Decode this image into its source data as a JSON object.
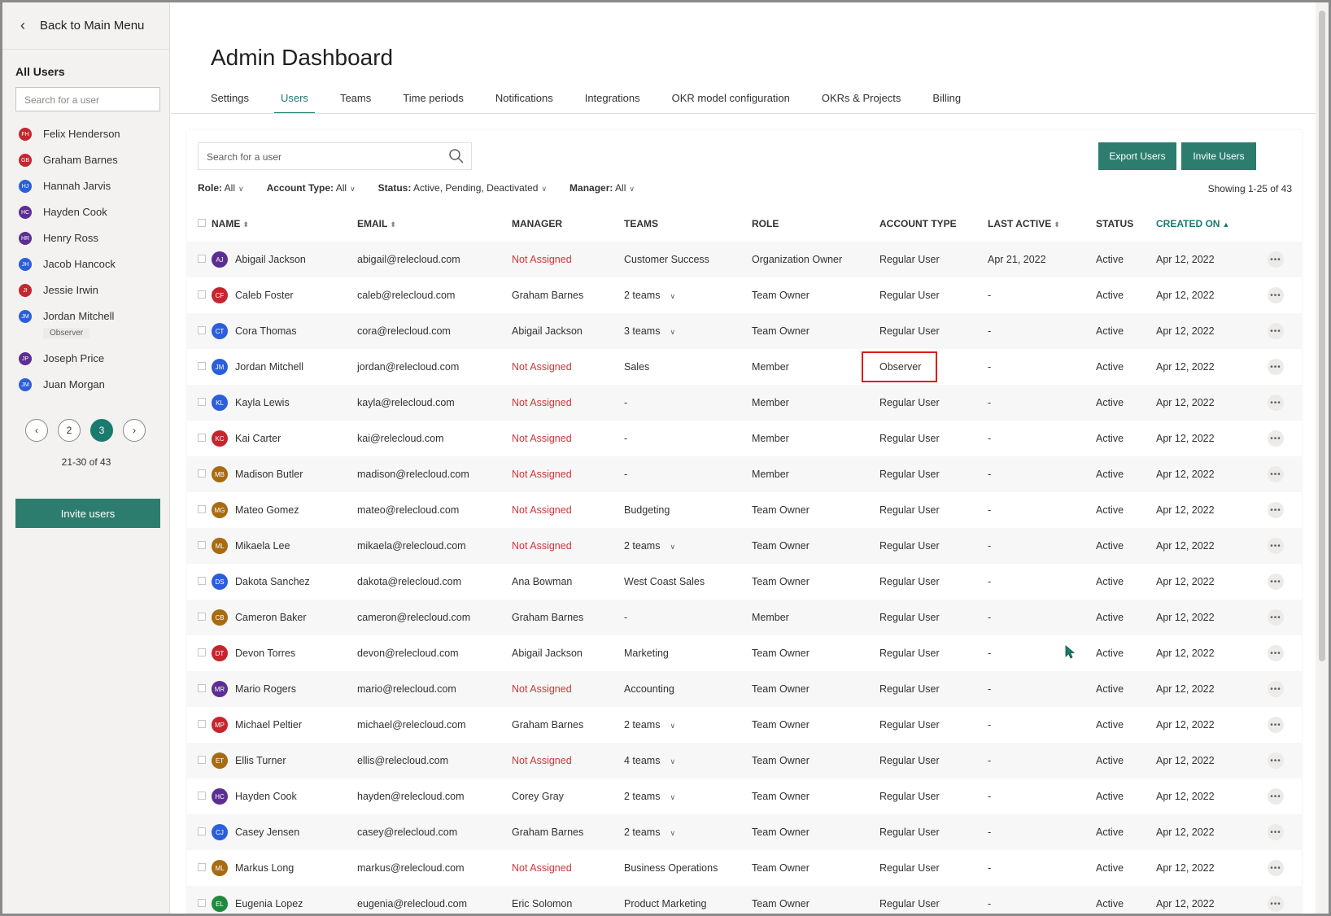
{
  "sidebar": {
    "back_label": "Back to Main Menu",
    "title": "All Users",
    "search_placeholder": "Search for a user",
    "users": [
      {
        "initials": "FH",
        "name": "Felix Henderson",
        "color": "#c4262e"
      },
      {
        "initials": "GB",
        "name": "Graham Barnes",
        "color": "#c4262e"
      },
      {
        "initials": "HJ",
        "name": "Hannah Jarvis",
        "color": "#2b5fd9"
      },
      {
        "initials": "HC",
        "name": "Hayden Cook",
        "color": "#5c2e91"
      },
      {
        "initials": "HR",
        "name": "Henry Ross",
        "color": "#5c2e91"
      },
      {
        "initials": "JH",
        "name": "Jacob Hancock",
        "color": "#2b5fd9"
      },
      {
        "initials": "JI",
        "name": "Jessie Irwin",
        "color": "#c4262e"
      },
      {
        "initials": "JM",
        "name": "Jordan Mitchell",
        "color": "#2b5fd9",
        "badge": "Observer"
      },
      {
        "initials": "JP",
        "name": "Joseph Price",
        "color": "#5c2e91"
      },
      {
        "initials": "JM",
        "name": "Juan Morgan",
        "color": "#2b5fd9"
      }
    ],
    "pager": {
      "prev": "‹",
      "pages": [
        "2",
        "3"
      ],
      "active": "3",
      "next": "›",
      "info": "21-30  of  43"
    },
    "invite_label": "Invite users"
  },
  "header": {
    "title": "Admin Dashboard",
    "tabs": [
      "Settings",
      "Users",
      "Teams",
      "Time periods",
      "Notifications",
      "Integrations",
      "OKR model configuration",
      "OKRs & Projects",
      "Billing"
    ],
    "active_tab": "Users"
  },
  "toolbar": {
    "search_placeholder": "Search for a user",
    "export_label": "Export Users",
    "invite_label": "Invite Users"
  },
  "filters": [
    {
      "label": "Role:",
      "value": "All"
    },
    {
      "label": "Account Type:",
      "value": "All"
    },
    {
      "label": "Status:",
      "value": "Active, Pending, Deactivated"
    },
    {
      "label": "Manager:",
      "value": "All"
    }
  ],
  "showing": "Showing 1-25 of 43",
  "table": {
    "columns": [
      "NAME",
      "EMAIL",
      "MANAGER",
      "TEAMS",
      "ROLE",
      "ACCOUNT TYPE",
      "LAST ACTIVE",
      "STATUS",
      "CREATED ON"
    ],
    "rows": [
      {
        "initials": "AJ",
        "color": "#5c2e91",
        "name": "Abigail Jackson",
        "email": "abigail@relecloud.com",
        "manager": "Not Assigned",
        "teams": "Customer Success",
        "teams_dd": false,
        "role": "Organization Owner",
        "account": "Regular User",
        "last": "Apr 21, 2022",
        "status": "Active",
        "created": "Apr 12, 2022"
      },
      {
        "initials": "CF",
        "color": "#c4262e",
        "name": "Caleb Foster",
        "email": "caleb@relecloud.com",
        "manager": "Graham Barnes",
        "teams": "2 teams",
        "teams_dd": true,
        "role": "Team Owner",
        "account": "Regular User",
        "last": "-",
        "status": "Active",
        "created": "Apr 12, 2022"
      },
      {
        "initials": "CT",
        "color": "#2b5fd9",
        "name": "Cora Thomas",
        "email": "cora@relecloud.com",
        "manager": "Abigail Jackson",
        "teams": "3 teams",
        "teams_dd": true,
        "role": "Team Owner",
        "account": "Regular User",
        "last": "-",
        "status": "Active",
        "created": "Apr 12, 2022"
      },
      {
        "initials": "JM",
        "color": "#2b5fd9",
        "name": "Jordan Mitchell",
        "email": "jordan@relecloud.com",
        "manager": "Not Assigned",
        "teams": "Sales",
        "teams_dd": false,
        "role": "Member",
        "account": "Observer",
        "highlight": true,
        "last": "-",
        "status": "Active",
        "created": "Apr 12, 2022"
      },
      {
        "initials": "KL",
        "color": "#2b5fd9",
        "name": "Kayla Lewis",
        "email": "kayla@relecloud.com",
        "manager": "Not Assigned",
        "teams": "-",
        "teams_dd": false,
        "role": "Member",
        "account": "Regular User",
        "last": "-",
        "status": "Active",
        "created": "Apr 12, 2022"
      },
      {
        "initials": "KC",
        "color": "#c4262e",
        "name": "Kai Carter",
        "email": "kai@relecloud.com",
        "manager": "Not Assigned",
        "teams": "-",
        "teams_dd": false,
        "role": "Member",
        "account": "Regular User",
        "last": "-",
        "status": "Active",
        "created": "Apr 12, 2022"
      },
      {
        "initials": "MB",
        "color": "#a86b12",
        "name": "Madison Butler",
        "email": "madison@relecloud.com",
        "manager": "Not Assigned",
        "teams": "-",
        "teams_dd": false,
        "role": "Member",
        "account": "Regular User",
        "last": "-",
        "status": "Active",
        "created": "Apr 12, 2022"
      },
      {
        "initials": "MG",
        "color": "#a86b12",
        "name": "Mateo Gomez",
        "email": "mateo@relecloud.com",
        "manager": "Not Assigned",
        "teams": "Budgeting",
        "teams_dd": false,
        "role": "Team Owner",
        "account": "Regular User",
        "last": "-",
        "status": "Active",
        "created": "Apr 12, 2022"
      },
      {
        "initials": "ML",
        "color": "#a86b12",
        "name": "Mikaela Lee",
        "email": "mikaela@relecloud.com",
        "manager": "Not Assigned",
        "teams": "2 teams",
        "teams_dd": true,
        "role": "Team Owner",
        "account": "Regular User",
        "last": "-",
        "status": "Active",
        "created": "Apr 12, 2022"
      },
      {
        "initials": "DS",
        "color": "#2b5fd9",
        "name": "Dakota Sanchez",
        "email": "dakota@relecloud.com",
        "manager": "Ana Bowman",
        "teams": "West Coast Sales",
        "teams_dd": false,
        "role": "Team Owner",
        "account": "Regular User",
        "last": "-",
        "status": "Active",
        "created": "Apr 12, 2022"
      },
      {
        "initials": "CB",
        "color": "#a86b12",
        "name": "Cameron Baker",
        "email": "cameron@relecloud.com",
        "manager": "Graham Barnes",
        "teams": "-",
        "teams_dd": false,
        "role": "Member",
        "account": "Regular User",
        "last": "-",
        "status": "Active",
        "created": "Apr 12, 2022"
      },
      {
        "initials": "DT",
        "color": "#c4262e",
        "name": "Devon Torres",
        "email": "devon@relecloud.com",
        "manager": "Abigail Jackson",
        "teams": "Marketing",
        "teams_dd": false,
        "role": "Team Owner",
        "account": "Regular User",
        "last": "-",
        "status": "Active",
        "created": "Apr 12, 2022"
      },
      {
        "initials": "MR",
        "color": "#5c2e91",
        "name": "Mario Rogers",
        "email": "mario@relecloud.com",
        "manager": "Not Assigned",
        "teams": "Accounting",
        "teams_dd": false,
        "role": "Team Owner",
        "account": "Regular User",
        "last": "-",
        "status": "Active",
        "created": "Apr 12, 2022"
      },
      {
        "initials": "MP",
        "color": "#c4262e",
        "name": "Michael Peltier",
        "email": "michael@relecloud.com",
        "manager": "Graham Barnes",
        "teams": "2 teams",
        "teams_dd": true,
        "role": "Team Owner",
        "account": "Regular User",
        "last": "-",
        "status": "Active",
        "created": "Apr 12, 2022"
      },
      {
        "initials": "ET",
        "color": "#a86b12",
        "name": "Ellis Turner",
        "email": "ellis@relecloud.com",
        "manager": "Not Assigned",
        "teams": "4 teams",
        "teams_dd": true,
        "role": "Team Owner",
        "account": "Regular User",
        "last": "-",
        "status": "Active",
        "created": "Apr 12, 2022"
      },
      {
        "initials": "HC",
        "color": "#5c2e91",
        "name": "Hayden Cook",
        "email": "hayden@relecloud.com",
        "manager": "Corey Gray",
        "teams": "2 teams",
        "teams_dd": true,
        "role": "Team Owner",
        "account": "Regular User",
        "last": "-",
        "status": "Active",
        "created": "Apr 12, 2022"
      },
      {
        "initials": "CJ",
        "color": "#2b5fd9",
        "name": "Casey Jensen",
        "email": "casey@relecloud.com",
        "manager": "Graham Barnes",
        "teams": "2 teams",
        "teams_dd": true,
        "role": "Team Owner",
        "account": "Regular User",
        "last": "-",
        "status": "Active",
        "created": "Apr 12, 2022"
      },
      {
        "initials": "ML",
        "color": "#a86b12",
        "name": "Markus Long",
        "email": "markus@relecloud.com",
        "manager": "Not Assigned",
        "teams": "Business Operations",
        "teams_dd": false,
        "role": "Team Owner",
        "account": "Regular User",
        "last": "-",
        "status": "Active",
        "created": "Apr 12, 2022"
      },
      {
        "initials": "EL",
        "color": "#1e8a3e",
        "name": "Eugenia Lopez",
        "email": "eugenia@relecloud.com",
        "manager": "Eric Solomon",
        "teams": "Product Marketing",
        "teams_dd": false,
        "role": "Team Owner",
        "account": "Regular User",
        "last": "-",
        "status": "Active",
        "created": "Apr 12, 2022"
      }
    ]
  },
  "colors": {
    "accent": "#1b7a6e",
    "button": "#2d7d6e",
    "not_assigned": "#d13438",
    "highlight_border": "#e01b1b"
  }
}
